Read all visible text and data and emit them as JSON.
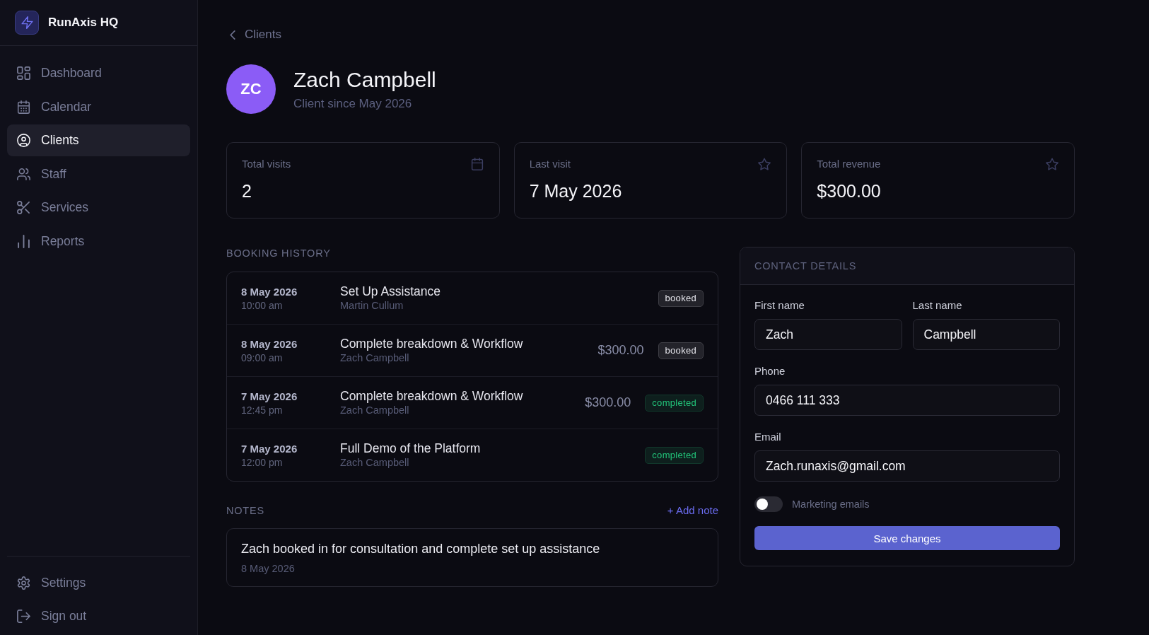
{
  "sidebar": {
    "brand": "RunAxis HQ",
    "items": [
      {
        "label": "Dashboard",
        "selected": false
      },
      {
        "label": "Calendar",
        "selected": false
      },
      {
        "label": "Clients",
        "selected": true
      },
      {
        "label": "Staff",
        "selected": false
      },
      {
        "label": "Services",
        "selected": false
      },
      {
        "label": "Reports",
        "selected": false
      }
    ],
    "footer_items": [
      {
        "label": "Settings"
      },
      {
        "label": "Sign out"
      }
    ]
  },
  "back_link": "Clients",
  "client": {
    "initials": "ZC",
    "name": "Zach Campbell",
    "subtitle": "Client since May 2026"
  },
  "stats": [
    {
      "label": "Total visits",
      "value": "2"
    },
    {
      "label": "Last visit",
      "value": "7 May 2026"
    },
    {
      "label": "Total revenue",
      "value": "$300.00"
    }
  ],
  "booking_history": {
    "title": "BOOKING HISTORY",
    "bookings": [
      {
        "date": "8 May 2026",
        "time": "10:00 am",
        "service": "Set Up Assistance",
        "staff": "Martin Cullum",
        "status": {
          "label": "booked",
          "color": "#e4e4ea"
        }
      },
      {
        "date": "8 May 2026",
        "time": "09:00 am",
        "service": "Complete breakdown & Workflow",
        "staff": "Zach Campbell",
        "price": "$300.00",
        "status": {
          "label": "booked",
          "color": "#e4e4ea"
        }
      },
      {
        "date": "7 May 2026",
        "time": "12:45 pm",
        "service": "Complete breakdown & Workflow",
        "staff": "Zach Campbell",
        "price": "$300.00",
        "status": {
          "label": "completed",
          "color": "#22c57a"
        }
      },
      {
        "date": "7 May 2026",
        "time": "12:00 pm",
        "service": "Full Demo of the Platform",
        "staff": "Zach Campbell",
        "status": {
          "label": "completed",
          "color": "#22c57a"
        }
      }
    ]
  },
  "notes": {
    "title": "NOTES",
    "add_label": "+ Add note",
    "items": [
      {
        "text": "Zach booked in for consultation and complete set up assistance",
        "date": "8 May 2026"
      }
    ]
  },
  "contact": {
    "title": "CONTACT DETAILS",
    "field_rows": [
      [
        {
          "label": "First name",
          "value": "Zach"
        },
        {
          "label": "Last name",
          "value": "Campbell"
        }
      ],
      [
        {
          "label": "Phone",
          "value": "0466 111 333"
        }
      ],
      [
        {
          "label": "Email",
          "value": "Zach.runaxis@gmail.com"
        }
      ]
    ],
    "marketing": {
      "label": "Marketing emails",
      "on": false
    },
    "save_label": "Save changes"
  }
}
